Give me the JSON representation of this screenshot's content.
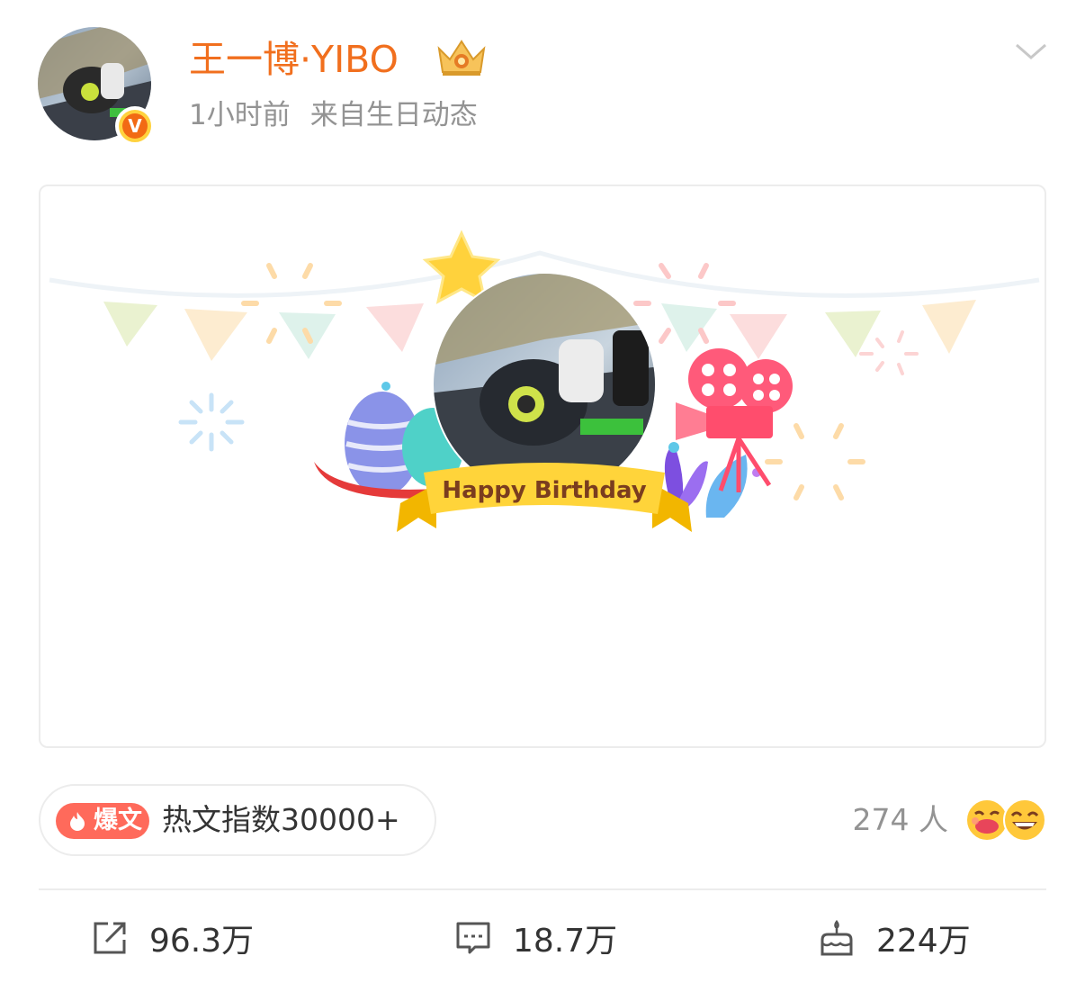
{
  "post": {
    "author_name": "王一博·YIBO",
    "time": "1小时前",
    "source": "来自生日动态",
    "verified_badge": "V",
    "card": {
      "banner_text": "Happy Birthday"
    },
    "hot": {
      "tag": "爆文",
      "text": "热文指数30000+"
    },
    "reactions": {
      "count": "274 人"
    },
    "actions": {
      "share": "96.3万",
      "comment": "18.7万",
      "like": "224万"
    }
  },
  "colors": {
    "name": "#f16f1e",
    "meta": "#939393",
    "hot_tag": "#ff6a5b",
    "text": "#333333"
  },
  "icons": [
    "crown-icon",
    "chevron-down-icon",
    "share-icon",
    "comment-icon",
    "cake-icon",
    "fire-icon"
  ]
}
